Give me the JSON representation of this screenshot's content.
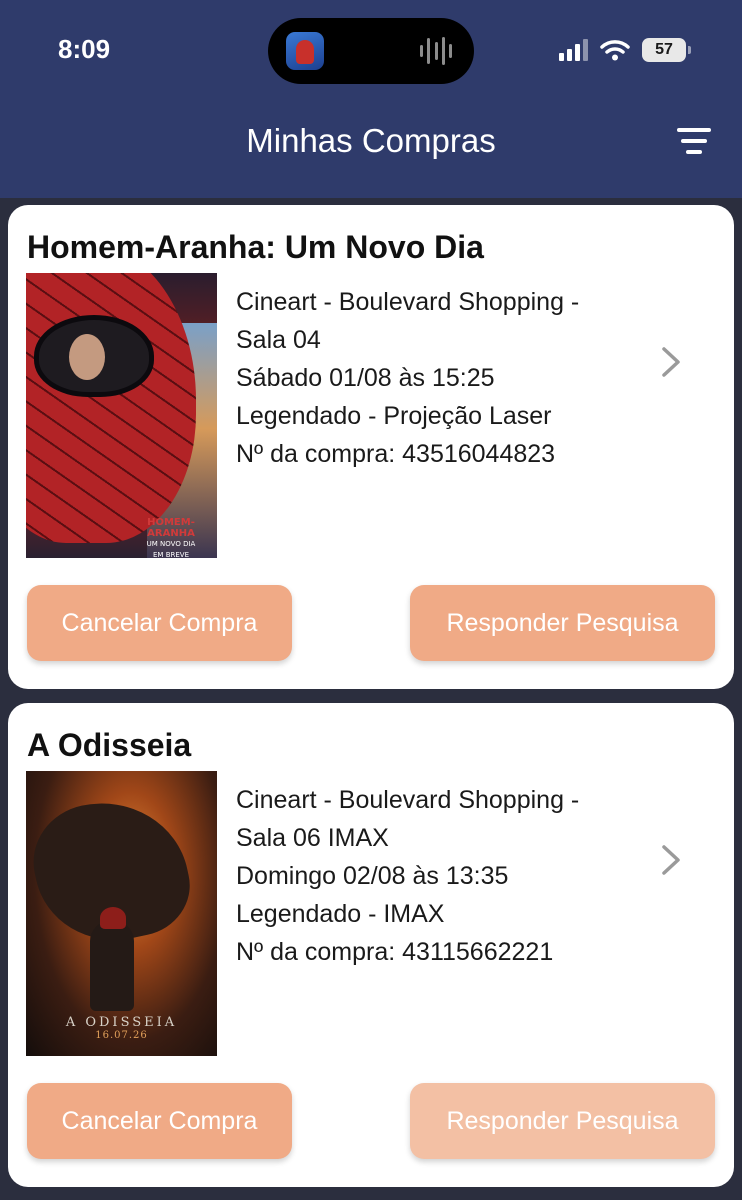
{
  "status_bar": {
    "time": "8:09",
    "battery": "57",
    "icons": [
      "cellular-signal-icon",
      "wifi-icon",
      "battery-icon"
    ]
  },
  "header": {
    "title": "Minhas Compras",
    "filter_icon": "filter-lines-icon",
    "background": "#2f3b6b"
  },
  "colors": {
    "button": "#f0aa86",
    "button_disabled": "#f3c0a4",
    "page_background": "#2b2e3e"
  },
  "purchases": [
    {
      "title": "Homem-Aranha: Um Novo Dia",
      "poster": {
        "logo": "HOMEM-ARANHA",
        "subtitle": "UM NOVO DIA",
        "tagline": "EM BREVE"
      },
      "cinema": "Cineart - Boulevard Shopping -",
      "room": "Sala 04",
      "datetime": "Sábado 01/08 às 15:25",
      "format": "Legendado - Projeção Laser",
      "order": "Nº da compra: 43516044823",
      "cancel_label": "Cancelar Compra",
      "survey_label": "Responder Pesquisa",
      "survey_enabled": true
    },
    {
      "title": "A Odisseia",
      "poster": {
        "logo": "A ODISSEIA",
        "date": "16.07.26"
      },
      "cinema": "Cineart - Boulevard Shopping -",
      "room": "Sala 06 IMAX",
      "datetime": "Domingo 02/08 às 13:35",
      "format": "Legendado - IMAX",
      "order": "Nº da compra: 43115662221",
      "cancel_label": "Cancelar Compra",
      "survey_label": "Responder Pesquisa",
      "survey_enabled": false
    }
  ]
}
